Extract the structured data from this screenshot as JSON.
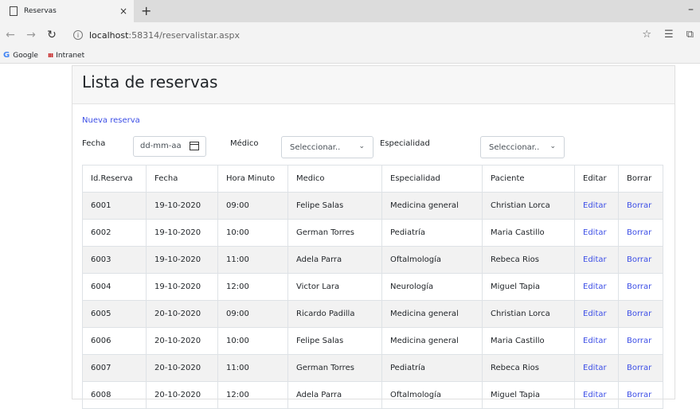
{
  "browser": {
    "tab_title": "Reservas",
    "tab_close": "×",
    "new_tab": "+",
    "url_host": "localhost",
    "url_path": ":58314/reservalistar.aspx",
    "bookmarks": [
      {
        "label": "Google",
        "icon": "google-icon"
      },
      {
        "label": "Intranet",
        "icon": "intranet-icon"
      }
    ]
  },
  "page": {
    "title": "Lista de reservas",
    "new_link": "Nueva reserva"
  },
  "filters": {
    "fecha_label": "Fecha",
    "fecha_placeholder": "dd-mm-aa",
    "medico_label": "Médico",
    "medico_value": "Seleccionar..",
    "especialidad_label": "Especialidad",
    "especialidad_value": "Seleccionar.."
  },
  "table": {
    "headers": [
      "Id.Reserva",
      "Fecha",
      "Hora Minuto",
      "Medico",
      "Especialidad",
      "Paciente",
      "Editar",
      "Borrar"
    ],
    "rows": [
      [
        "6001",
        "19-10-2020",
        "09:00",
        "Felipe Salas",
        "Medicina general",
        "Christian Lorca",
        "Editar",
        "Borrar"
      ],
      [
        "6002",
        "19-10-2020",
        "10:00",
        "German Torres",
        "Pediatría",
        "Maria Castillo",
        "Editar",
        "Borrar"
      ],
      [
        "6003",
        "19-10-2020",
        "11:00",
        "Adela Parra",
        "Oftalmología",
        "Rebeca Rios",
        "Editar",
        "Borrar"
      ],
      [
        "6004",
        "19-10-2020",
        "12:00",
        "Victor Lara",
        "Neurología",
        "Miguel Tapia",
        "Editar",
        "Borrar"
      ],
      [
        "6005",
        "20-10-2020",
        "09:00",
        "Ricardo Padilla",
        "Medicina general",
        "Christian Lorca",
        "Editar",
        "Borrar"
      ],
      [
        "6006",
        "20-10-2020",
        "10:00",
        "Felipe Salas",
        "Medicina general",
        "Maria Castillo",
        "Editar",
        "Borrar"
      ],
      [
        "6007",
        "20-10-2020",
        "11:00",
        "German Torres",
        "Pediatría",
        "Rebeca Rios",
        "Editar",
        "Borrar"
      ],
      [
        "6008",
        "20-10-2020",
        "12:00",
        "Adela Parra",
        "Oftalmología",
        "Miguel Tapia",
        "Editar",
        "Borrar"
      ]
    ]
  },
  "colors": {
    "link": "#3d4fe6",
    "stripe": "#f2f2f2",
    "header_bg": "#f7f7f7"
  }
}
